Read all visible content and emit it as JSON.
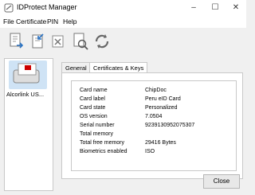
{
  "window": {
    "title": "IDProtect Manager",
    "controls": [
      "–",
      "☐",
      "✕"
    ]
  },
  "menu": {
    "items": [
      "File",
      "Certificate",
      "PIN",
      "Help"
    ]
  },
  "toolbar": {
    "icons": [
      "export-icon",
      "import-icon",
      "delete-icon",
      "view-icon",
      "refresh-icon"
    ]
  },
  "sidebar": {
    "items": [
      {
        "label": "Alcorlink US..."
      }
    ]
  },
  "tabs": {
    "general": "General",
    "certs": "Certificates & Keys"
  },
  "info": {
    "rows": [
      {
        "label": "Card name",
        "value": "ChipDoc"
      },
      {
        "label": "Card label",
        "value": "Peru eID Card"
      },
      {
        "label": "Card state",
        "value": "Personalized"
      },
      {
        "label": "OS version",
        "value": "7.0504"
      },
      {
        "label": "Serial number",
        "value": "9239130952075307"
      },
      {
        "label": "Total memory",
        "value": ""
      },
      {
        "label": "Total free memory",
        "value": "29416 Bytes"
      },
      {
        "label": "Biometrics enabled",
        "value": "ISO"
      }
    ]
  },
  "footer": {
    "close_label": "Close"
  }
}
